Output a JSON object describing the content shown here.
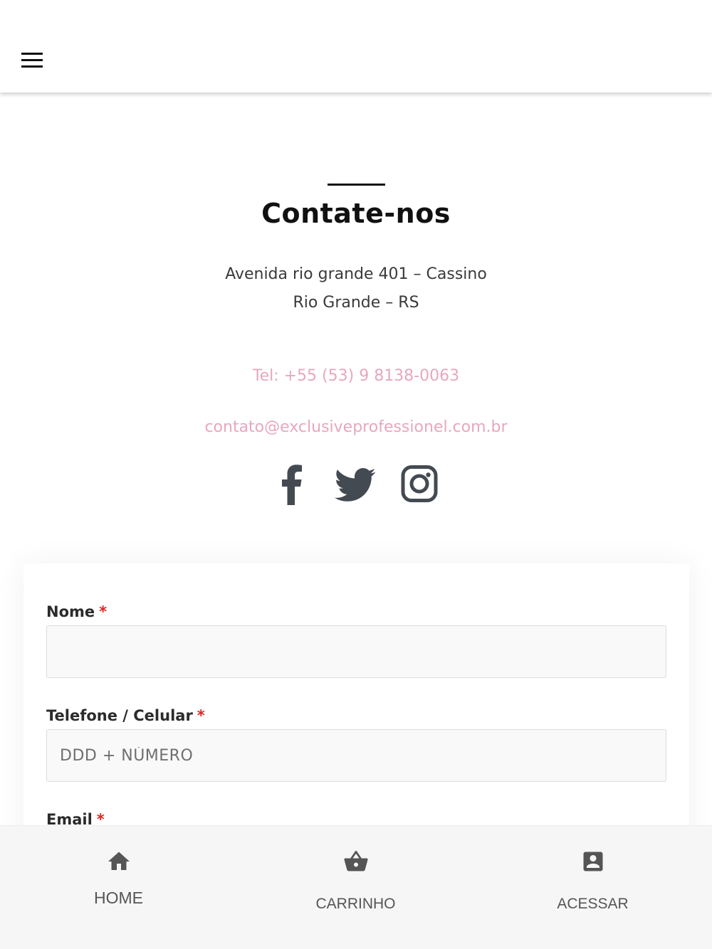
{
  "header": {
    "menu_icon": "hamburger-menu-icon"
  },
  "contact": {
    "title": "Contate-nos",
    "address_line1": "Avenida rio grande 401 – Cassino",
    "address_line2": "Rio Grande – RS",
    "phone": "Tel: +55 (53) 9 8138-0063",
    "email": "contato@exclusiveprofessionel.com.br",
    "link_color": "#e8a7bf",
    "social": [
      {
        "icon": "facebook-icon"
      },
      {
        "icon": "twitter-icon"
      },
      {
        "icon": "instagram-icon"
      }
    ]
  },
  "form": {
    "name_label": "Nome",
    "name_value": "",
    "phone_label": "Telefone / Celular",
    "phone_placeholder": "DDD + NÚMERO",
    "email_label": "Email",
    "required_mark": "*",
    "required_color": "#e02424"
  },
  "bottom_nav": {
    "items": [
      {
        "label": "HOME",
        "icon": "home-icon"
      },
      {
        "label": "CARRINHO",
        "icon": "basket-icon"
      },
      {
        "label": "ACESSAR",
        "icon": "account-box-icon"
      }
    ]
  }
}
